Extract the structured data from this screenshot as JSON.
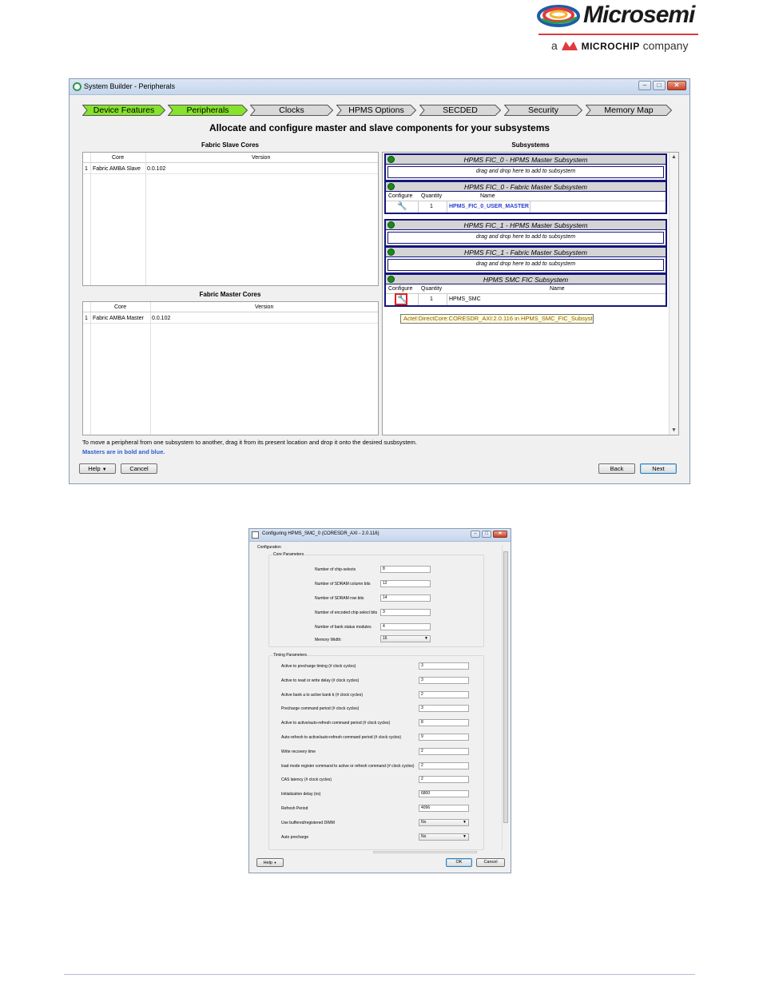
{
  "logo": {
    "brand": "Microsemi",
    "tagline_pre": "a",
    "tagline_brand": "MICROCHIP",
    "tagline_post": "company",
    "colors": {
      "red": "#e03a3e",
      "blue": "#1d5ca8",
      "green": "#2d9b4b"
    }
  },
  "window1": {
    "title": "System Builder - Peripherals",
    "steps": [
      {
        "label": "Device Features",
        "state": "done"
      },
      {
        "label": "Peripherals",
        "state": "current"
      },
      {
        "label": "Clocks",
        "state": "pending"
      },
      {
        "label": "HPMS Options",
        "state": "pending"
      },
      {
        "label": "SECDED",
        "state": "pending"
      },
      {
        "label": "Security",
        "state": "pending"
      },
      {
        "label": "Memory Map",
        "state": "pending"
      }
    ],
    "heading": "Allocate and configure master and slave components for your subsystems",
    "slave_panel": {
      "title": "Fabric Slave Cores",
      "col_core": "Core",
      "col_version": "Version",
      "rows": [
        {
          "n": "1",
          "core": "Fabric AMBA Slave",
          "version": "0.0.102"
        }
      ]
    },
    "master_panel": {
      "title": "Fabric Master Cores",
      "col_core": "Core",
      "col_version": "Version",
      "rows": [
        {
          "n": "1",
          "core": "Fabric AMBA Master",
          "version": "0.0.102"
        }
      ]
    },
    "subsystems_title": "Subsystems",
    "drop_text": "drag and drop here to add to subsystem",
    "col_configure": "Configure",
    "col_quantity": "Quantity",
    "col_name": "Name",
    "subsystems": [
      {
        "title": "HPMS FIC_0 - HPMS Master Subsystem"
      },
      {
        "title": "HPMS FIC_0 - Fabric Master Subsystem",
        "item": {
          "quantity": "1",
          "name": "HPMS_FIC_0_USER_MASTER"
        }
      },
      {
        "title": "HPMS FIC_1 - HPMS Master Subsystem"
      },
      {
        "title": "HPMS FIC_1 - Fabric Master Subsystem"
      },
      {
        "title": "HPMS SMC FIC Subsystem",
        "item": {
          "quantity": "1",
          "name": "HPMS_SMC"
        }
      }
    ],
    "tooltip": "Actel:DirectCore:CORESDR_AXI:2.0.116 in HPMS_SMC_FIC_Subsystem",
    "note1": "To move a peripheral from one subsystem to another, drag it from its present location and drop it onto the desired susbsystem.",
    "note2": "Masters are in bold and blue.",
    "buttons": {
      "help": "Help",
      "cancel": "Cancel",
      "back": "Back",
      "next": "Next"
    }
  },
  "window2": {
    "title": "Configuring HPMS_SMC_0 (CORESDR_AXI - 2.0.116)",
    "config_label": "Configuration",
    "core_params": {
      "title": "Core Parameters",
      "fields": [
        {
          "label": "Number of chip-selects",
          "value": "8"
        },
        {
          "label": "Number of SDRAM column bits",
          "value": "12"
        },
        {
          "label": "Number of SDRAM row bits",
          "value": "14"
        },
        {
          "label": "Number of encoded chip select bits",
          "value": "3"
        },
        {
          "label": "Number of bank status modules",
          "value": "4"
        }
      ],
      "memory_width": {
        "label": "Memory Width:",
        "value": "16"
      }
    },
    "timing_params": {
      "title": "Timing Parameters",
      "fields": [
        {
          "label": "Active to precharge timing (# clock cycles)",
          "value": "3"
        },
        {
          "label": "Active to read or write delay (# clock cycles)",
          "value": "3"
        },
        {
          "label": "Active bank a to active bank b (# clock cycles)",
          "value": "2"
        },
        {
          "label": "Precharge command period (# clock cycles)",
          "value": "3"
        },
        {
          "label": "Active to active/auto-refresh command period (# clock cycles)",
          "value": "8"
        },
        {
          "label": "Auto-refresh to active/auto-refresh command period (# clock cycles)",
          "value": "9"
        },
        {
          "label": "Write recovery time",
          "value": "2"
        },
        {
          "label": "load mode register command to active or refresh command (# clock cycles)",
          "value": "2"
        },
        {
          "label": "CAS latency (# clock cycles)",
          "value": "2"
        },
        {
          "label": "Initialization delay (ns)",
          "value": "6800"
        },
        {
          "label": "Refresh Period",
          "value": "4096"
        }
      ],
      "selects": [
        {
          "label": "Use buffered/registered DIMM",
          "value": "No"
        },
        {
          "label": "Auto precharge",
          "value": "No"
        }
      ]
    },
    "buttons": {
      "help": "Help",
      "ok": "OK",
      "cancel": "Cancel"
    }
  }
}
